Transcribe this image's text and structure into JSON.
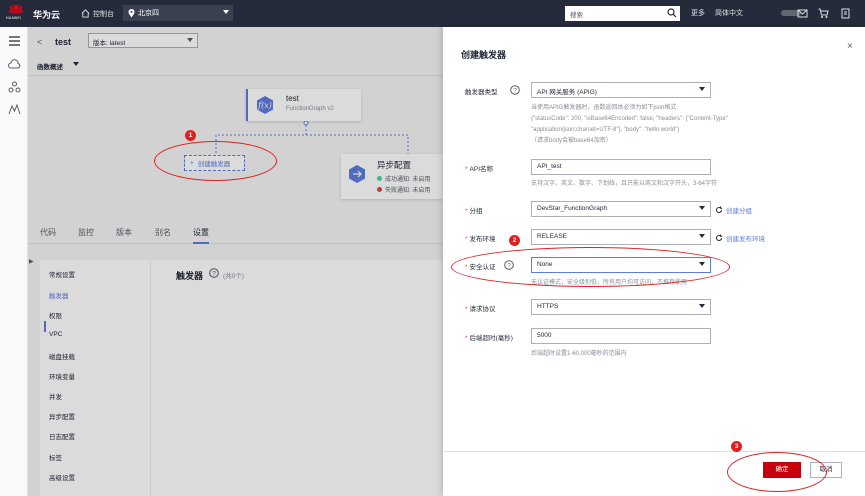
{
  "topbar": {
    "logo_text": "HUAWEI",
    "brand": "华为云",
    "console": "控制台",
    "region": "北京四",
    "search_placeholder": "搜索",
    "more": "更多",
    "language": "简体中文"
  },
  "function": {
    "back": "<",
    "name": "test",
    "version_select": "版本: latest",
    "overview": "函数概述",
    "card_title": "test",
    "card_subtitle": "FunctionGraph v2",
    "create_trigger": "创建触发器",
    "async_title": "异步配置",
    "async_success": "成功通知: 未启用",
    "async_fail": "失败通知: 未启用"
  },
  "tabs": [
    "代码",
    "监控",
    "版本",
    "别名",
    "设置"
  ],
  "active_tab": "设置",
  "settings_nav": [
    "常规设置",
    "触发器",
    "权限",
    "VPC",
    "磁盘挂载",
    "环境变量",
    "并发",
    "异步配置",
    "日志配置",
    "标签",
    "高级设置"
  ],
  "active_settings": "触发器",
  "trigger_panel": {
    "title": "触发器",
    "count": "(共0个)"
  },
  "drawer": {
    "title": "创建触发器",
    "close": "×",
    "trigger_type_label": "触发器类型",
    "trigger_type_value": "API 网关服务 (APIG)",
    "trigger_type_hint_1": "当使用APIG触发器时，函数返回体必须为如下json格式:",
    "trigger_type_hint_2": "{\"statusCode\": 200, \"isBase64Encoded\": false, \"headers\": {\"Content-Type\"",
    "trigger_type_hint_3": "\"application/json;charset=UTF-8\"}, \"body\": \"hello world\"}",
    "trigger_type_hint_4": "（请求body会被base64加密）",
    "api_name_label": "API名称",
    "api_name_value": "API_test",
    "api_name_hint": "支持汉字、英文、数字、下划线，且只能以英文和汉字开头，3-64字符",
    "group_label": "分组",
    "group_value": "DevStar_FunctionGraph",
    "group_link": "创建分组",
    "env_label": "发布环境",
    "env_value": "RELEASE",
    "env_link": "创建发布环境",
    "auth_label": "安全认证",
    "auth_value": "None",
    "auth_hint": "无认证模式，安全级别低，所有用户均可访问，不推荐使用",
    "protocol_label": "请求协议",
    "protocol_value": "HTTPS",
    "timeout_label": "后端超时(毫秒)",
    "timeout_value": "5000",
    "timeout_hint": "后端超时设置1-60,000毫秒的范围内",
    "ok": "确定",
    "cancel": "取消"
  },
  "annotations": [
    "1",
    "2",
    "3"
  ],
  "colors": {
    "topbar": "#252b3a",
    "accent": "#5e7ce0",
    "primary_button": "#c7000b",
    "annotation": "#e02020"
  }
}
